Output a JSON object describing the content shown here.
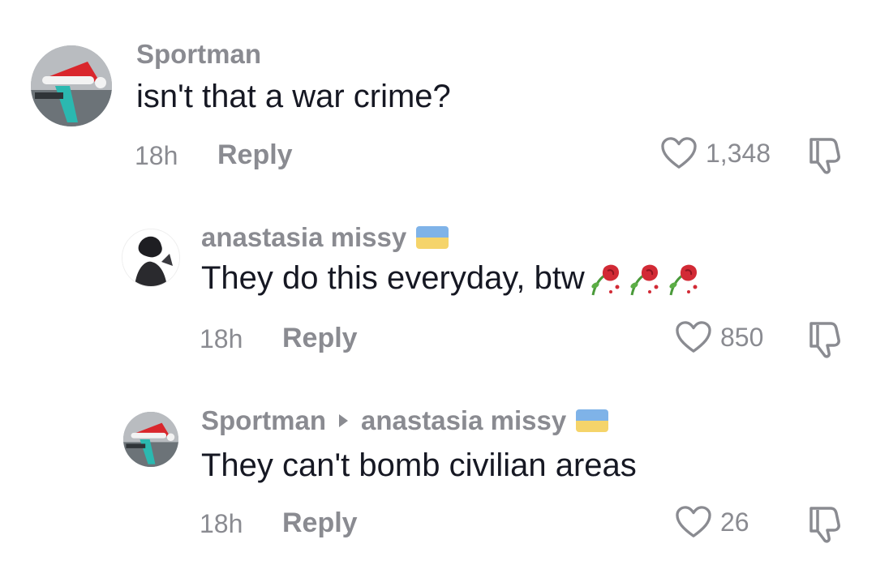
{
  "comments": [
    {
      "username": "Sportman",
      "text": "isn't that a war crime?",
      "time": "18h",
      "reply_label": "Reply",
      "likes": "1,348"
    },
    {
      "username": "anastasia missy",
      "text": "They do this everyday, btw",
      "time": "18h",
      "reply_label": "Reply",
      "likes": "850"
    },
    {
      "username": "Sportman",
      "reply_to": "anastasia missy",
      "text": "They can't bomb civilian areas",
      "time": "18h",
      "reply_label": "Reply",
      "likes": "26"
    }
  ],
  "colors": {
    "username": "#8a8b91",
    "text": "#161823",
    "flag_blue": "#7fb3e8",
    "flag_yellow": "#f5d46a"
  },
  "icons": [
    "heart-icon",
    "dislike-icon",
    "wilted-rose-emoji",
    "ukraine-flag-icon",
    "santa-hat-avatar"
  ]
}
